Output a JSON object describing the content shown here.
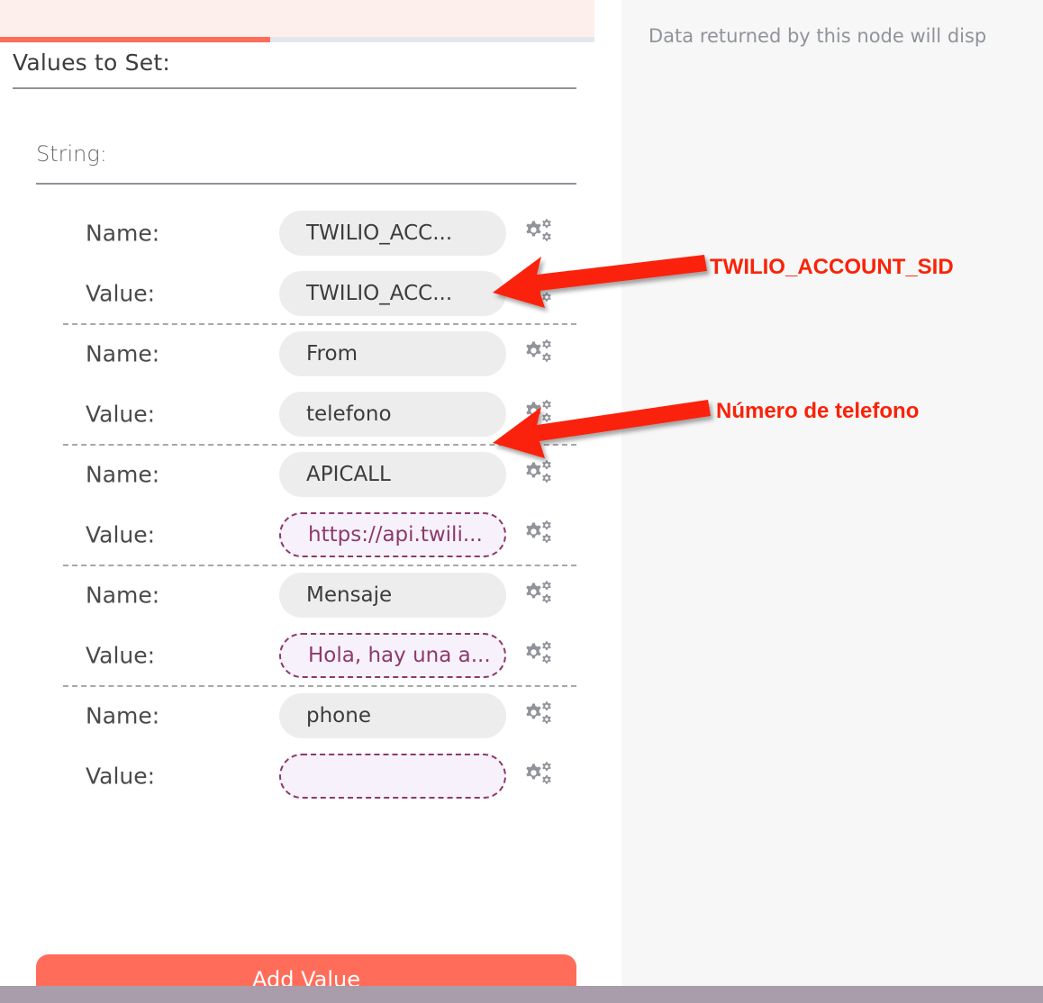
{
  "panel": {
    "section_title": "Values to Set:",
    "subsection_title": "String:",
    "add_button_label": "Add Value"
  },
  "right_panel": {
    "placeholder_text": "Data returned by this node will disp"
  },
  "rows": [
    {
      "name_label": "Name:",
      "name_value": "TWILIO_ACC...",
      "name_is_expression": false,
      "value_label": "Value:",
      "value_value": "TWILIO_ACC...",
      "value_is_expression": false
    },
    {
      "name_label": "Name:",
      "name_value": "From",
      "name_is_expression": false,
      "value_label": "Value:",
      "value_value": "telefono",
      "value_is_expression": false
    },
    {
      "name_label": "Name:",
      "name_value": "APICALL",
      "name_is_expression": false,
      "value_label": "Value:",
      "value_value": "https://api.twili...",
      "value_is_expression": true
    },
    {
      "name_label": "Name:",
      "name_value": "Mensaje",
      "name_is_expression": false,
      "value_label": "Value:",
      "value_value": "Hola, hay una a...",
      "value_is_expression": true
    },
    {
      "name_label": "Name:",
      "name_value": "phone",
      "name_is_expression": false,
      "value_label": "Value:",
      "value_value": "",
      "value_is_expression": true
    }
  ],
  "annotations": [
    {
      "id": "twilio-sid",
      "text": "TWILIO_ACCOUNT_SID"
    },
    {
      "id": "phone-number",
      "text": "Número de telefono"
    }
  ],
  "colors": {
    "accent": "#ff6d5a",
    "annotation_red": "#fa2207",
    "expression_purple": "#8c3a6c",
    "expression_bg": "#f7f1fb",
    "pill_gray": "#ededed",
    "scrollbar": "#ffc0b8",
    "right_panel_bg": "#f7f7f7",
    "bottom_bar": "#a99cab"
  }
}
